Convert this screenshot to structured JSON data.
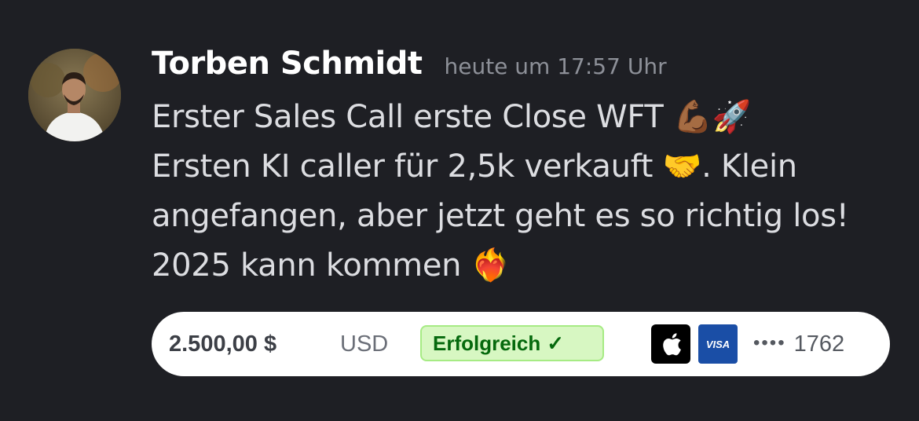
{
  "message": {
    "author": "Torben Schmidt",
    "timestamp": "heute um 17:57 Uhr",
    "lines": [
      {
        "text": "Erster Sales Call erste Close WFT ",
        "emoji": "💪🏾🚀"
      },
      {
        "text": "Ersten KI caller für 2,5k verkauft ",
        "emoji": "🤝",
        "tail": ". Klein"
      },
      {
        "text": "angefangen, aber jetzt geht es so richtig los!"
      },
      {
        "text": "2025 kann kommen ",
        "emoji": "❤️‍🔥"
      }
    ]
  },
  "payment": {
    "amount": "2.500,00 $",
    "currency": "USD",
    "status": "Erfolgreich",
    "status_icon": "check-icon",
    "wallet_icon": "apple-pay-icon",
    "card_brand": "VISA",
    "card_mask": "••••",
    "card_last4": "1762",
    "colors": {
      "status_bg": "#d7f7c2",
      "status_text": "#05690d",
      "visa_bg": "#1a4ea6"
    }
  }
}
